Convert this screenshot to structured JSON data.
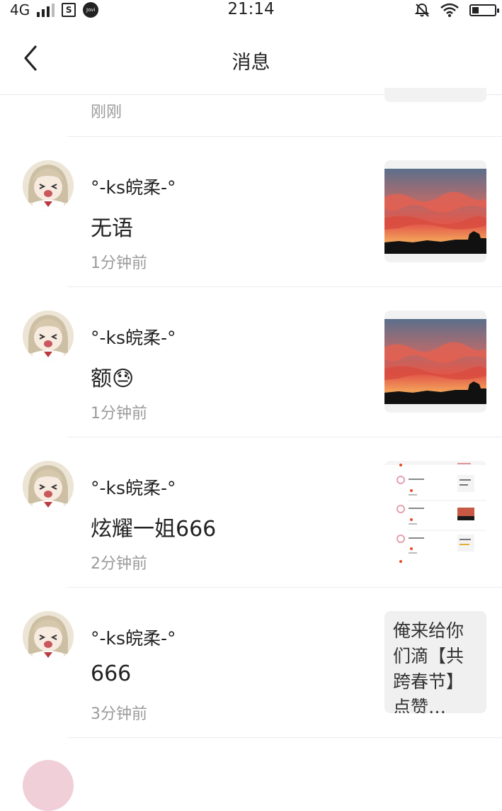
{
  "status_bar": {
    "network": "4G",
    "time": "21:14",
    "battery_level": 0.3,
    "icons": [
      "signal-icon",
      "sim-icon",
      "jovi-icon",
      "mute-icon",
      "wifi-icon",
      "battery-icon"
    ]
  },
  "header": {
    "title": "消息",
    "back_icon": "back-icon"
  },
  "top_partial": {
    "time": "刚刚"
  },
  "messages": [
    {
      "username": "°-ks皖柔-°",
      "content": "无语",
      "time": "1分钟前",
      "thumb": "sunset-image"
    },
    {
      "username": "°-ks皖柔-°",
      "content": "额😓",
      "time": "1分钟前",
      "thumb": "sunset-image"
    },
    {
      "username": "°-ks皖柔-°",
      "content": "炫耀一姐666",
      "time": "2分钟前",
      "thumb": "screenshot-image"
    },
    {
      "username": "°-ks皖柔-°",
      "content": "666",
      "time": "3分钟前",
      "thumb_text": "俺来给你们滴【共跨春节】点赞…"
    }
  ]
}
